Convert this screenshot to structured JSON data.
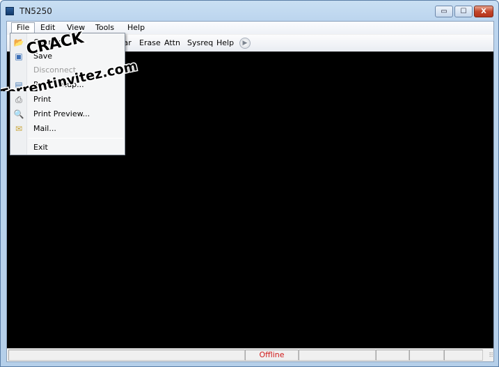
{
  "window": {
    "title": "TN5250",
    "controls": {
      "minimize": "▭",
      "maximize": "☐",
      "close": "X"
    }
  },
  "menubar": {
    "items": [
      {
        "label": "File",
        "open": true
      },
      {
        "label": "Edit"
      },
      {
        "label": "View"
      },
      {
        "label": "Tools"
      },
      {
        "label": "Help"
      }
    ]
  },
  "toolbar": {
    "items": [
      "Clear",
      "Erase",
      "Attn",
      "Sysreq",
      "Help"
    ],
    "more_glyph": "▶"
  },
  "file_menu": {
    "items": [
      {
        "label": "Connect",
        "icon": "folder-open-icon",
        "enabled": true
      },
      {
        "label": "Save",
        "icon": "disk-icon",
        "enabled": true
      },
      {
        "label": "Disconnect",
        "icon": "",
        "enabled": false
      },
      {
        "label": "Page Setup...",
        "icon": "page-setup-icon",
        "enabled": true
      },
      {
        "label": "Print",
        "icon": "printer-icon",
        "enabled": true
      },
      {
        "label": "Print Preview...",
        "icon": "print-preview-icon",
        "enabled": true
      },
      {
        "label": "Mail...",
        "icon": "mail-icon",
        "enabled": true
      }
    ],
    "exit_label": "Exit"
  },
  "statusbar": {
    "connection_status": "Offline",
    "grip": "⠿"
  },
  "watermark": {
    "line1": "CRACK",
    "line2": "Torrentinvitez.com"
  },
  "colors": {
    "terminal_bg": "#000000",
    "status_offline": "#d01a1a",
    "window_frame": "#bcd5ee"
  }
}
